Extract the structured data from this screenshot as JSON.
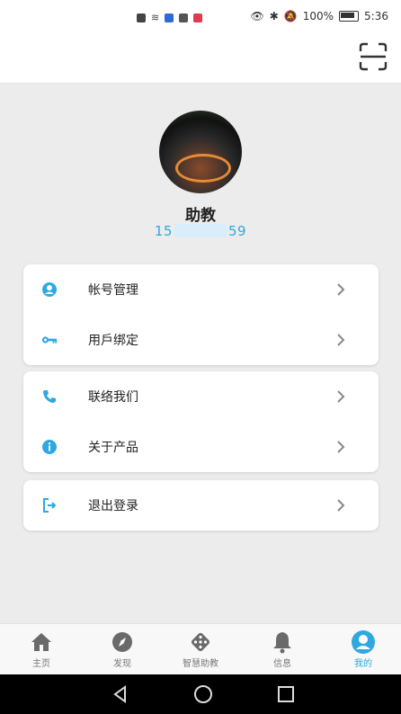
{
  "status_bar": {
    "battery": "100%",
    "time": "5:36"
  },
  "profile": {
    "name": "助教",
    "phone_prefix": "15",
    "phone_suffix": "59"
  },
  "menu": {
    "group1": [
      {
        "label": "帐号管理",
        "icon": "account-circle-icon"
      },
      {
        "label": "用戶绑定",
        "icon": "key-icon"
      }
    ],
    "group2": [
      {
        "label": "联络我们",
        "icon": "phone-icon"
      },
      {
        "label": "关于产品",
        "icon": "info-icon"
      }
    ],
    "group3": [
      {
        "label": "退出登录",
        "icon": "logout-icon"
      }
    ]
  },
  "nav": {
    "items": [
      {
        "label": "主页",
        "icon": "home-icon"
      },
      {
        "label": "发现",
        "icon": "compass-icon"
      },
      {
        "label": "智慧助教",
        "icon": "dice-icon"
      },
      {
        "label": "信息",
        "icon": "bell-icon"
      },
      {
        "label": "我的",
        "icon": "profile-icon"
      }
    ],
    "active_index": 4
  },
  "colors": {
    "accent": "#2fa8e0",
    "page_bg": "#ececec",
    "card_bg": "#ffffff"
  }
}
